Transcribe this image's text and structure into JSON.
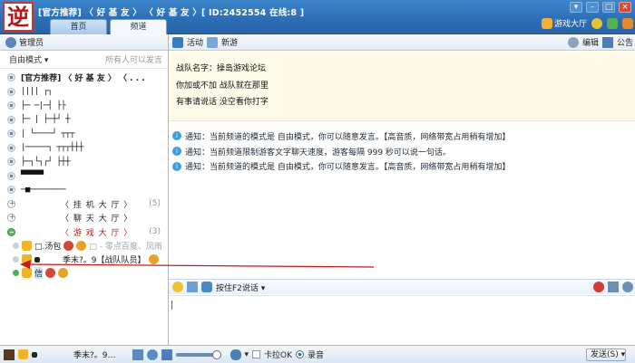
{
  "header": {
    "logo_char": "逆",
    "title": "[官方推荐] 〈 好 基 友 〉 〈 好 基 友 〉[ ID:2452554 在线:8 ]",
    "tabs": [
      {
        "label": "首页"
      },
      {
        "label": "频道"
      }
    ],
    "lobby_label": "游戏大厅"
  },
  "left": {
    "header_label": "管理员",
    "mode_label": "自由模式",
    "mode_desc": "所有人可以发言",
    "tree": {
      "root_label": "[官方推荐] 〈 好 基 友 〉 〈 . . .",
      "art_lines": [
        "         ||||     ┌┐",
        "├─  ─|─┤  ├├",
        "├─  |  ├─┼┘  ┼",
        "|  └────┘       ┬┬┬",
        "|─────┐  ┬┬┬┼┼┼",
        "  ├─┐└┐┌┘  ├┼┼",
        "      ▀▀▀▀▀",
        "   ─■────────"
      ],
      "channels": [
        {
          "label": "〈 挂 机 大 厅 〉",
          "count": "(5)",
          "highlight": false
        },
        {
          "label": "〈 聊 天 大 厅 〉",
          "count": "",
          "highlight": false
        },
        {
          "label": "〈 游 戏 大 厅 〉",
          "count": "(3)",
          "highlight": true
        }
      ],
      "members": [
        {
          "name": "□.汤包",
          "extra": "□ - 零点百度、凤雨"
        },
        {
          "name": "季末?。9【战队队员】",
          "extra": ""
        },
        {
          "name": "信",
          "extra": ""
        }
      ]
    }
  },
  "right": {
    "toolbar": {
      "activity_label": "活动",
      "newgame_label": "新游",
      "edit_label": "编辑",
      "announce_label": "公告"
    },
    "notice_lines": [
      "战队名字：操岛游戏论坛",
      "你加或不加 战队就在那里",
      "有事请说话  没空看你打字"
    ],
    "messages": [
      "通知：当前频道的模式是 自由模式，你可以随意发言。【高音质，网络带宽占用稍有增加】",
      "通知：当前频道限制游客文字聊天速度，游客每隔 999 秒可以说一句话。",
      "通知：当前频道的模式是 自由模式，你可以随意发言。【高音质，网络带宽占用稍有增加】"
    ],
    "input_bar": {
      "ptt_label": "按住F2说话"
    }
  },
  "bottom": {
    "nickname": "季末?。9…",
    "karaoke_label": "卡拉OK",
    "record_label": "录音",
    "send_label": "发送(S)"
  },
  "colors": {
    "accent": "#2c6db4",
    "highlight": "#c81010"
  }
}
